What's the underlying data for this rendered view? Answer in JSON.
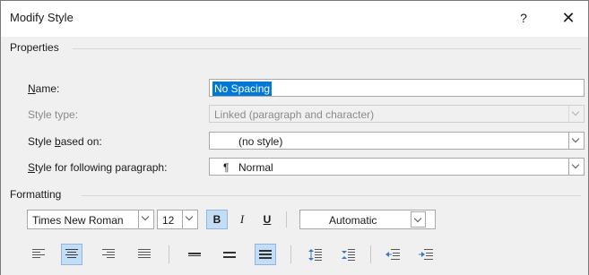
{
  "window": {
    "title": "Modify Style",
    "help_glyph": "?",
    "close_glyph": "✕"
  },
  "properties": {
    "heading": "Properties",
    "name_label_pre": "",
    "name_label_mnemonic": "N",
    "name_label_post": "ame:",
    "name_value": "No Spacing",
    "style_type_label": "Style type:",
    "style_type_value": "Linked (paragraph and character)",
    "based_on_label_pre": "Style ",
    "based_on_label_mnemonic": "b",
    "based_on_label_post": "ased on:",
    "based_on_value": "(no style)",
    "following_label_pre": "",
    "following_label_mnemonic": "S",
    "following_label_post": "tyle for following paragraph:",
    "following_value_icon": "¶",
    "following_value": "Normal"
  },
  "formatting": {
    "heading": "Formatting",
    "font": "Times New Roman",
    "size": "12",
    "bold": "B",
    "italic": "I",
    "underline": "U",
    "color": "Automatic",
    "bold_active": true,
    "alignment_active": "center",
    "spacing_active": "single"
  },
  "colors": {
    "selection": "#0078d7",
    "active_button_bg": "#c5dcf5",
    "dialog_bg": "#f0f0f0"
  }
}
